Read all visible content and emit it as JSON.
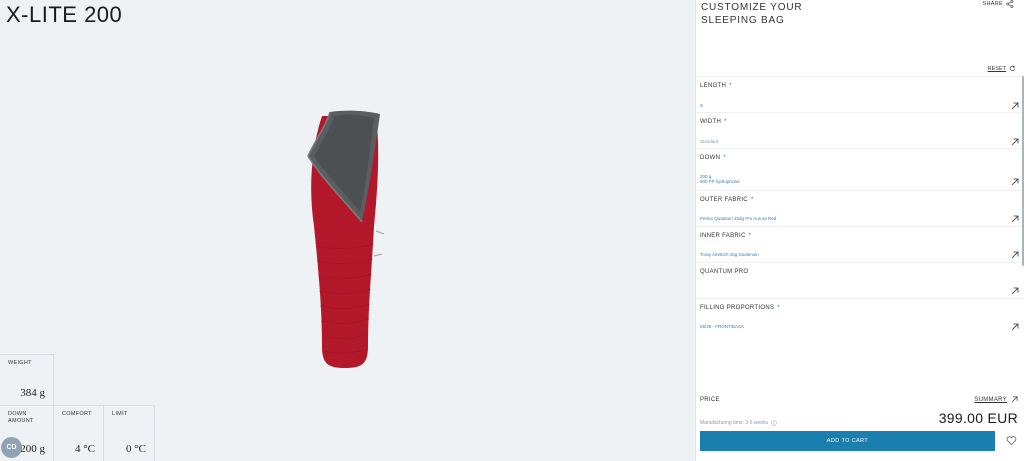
{
  "product": {
    "title": "X-LITE 200"
  },
  "stats": {
    "weight_label": "WEIGHT",
    "weight_value": "384 g",
    "down_amount_label": "DOWN AMOUNT",
    "down_amount_value": "200 g",
    "comfort_label": "COMFORT",
    "comfort_value": "4 °C",
    "limit_label": "LIMIT",
    "limit_value": "0 °C"
  },
  "chat": {
    "label": "CD"
  },
  "panel": {
    "title": "CUSTOMIZE YOUR SLEEPING BAG",
    "share_label": "SHARE",
    "reset_label": "RESET"
  },
  "options": [
    {
      "label": "LENGTH",
      "required": "*",
      "value": "S",
      "value2": ""
    },
    {
      "label": "WIDTH",
      "required": "*",
      "value": "Standard",
      "value2": ""
    },
    {
      "label": "DOWN",
      "required": "*",
      "value": "200 g",
      "value2": "900 FP hydrophobic"
    },
    {
      "label": "OUTER FABRIC",
      "required": "*",
      "value": "Pertex Quantum 15dg Pro Aurora Red",
      "value2": ""
    },
    {
      "label": "INNER FABRIC",
      "required": "*",
      "value": "Toray Airetech 15g Gaslenoin",
      "value2": ""
    },
    {
      "label": "QUANTUM PRO",
      "required": "",
      "value": "",
      "value2": ""
    },
    {
      "label": "FILLING PROPORTIONS",
      "required": "*",
      "value": "65/35 - FRONT/BACK",
      "value2": ""
    }
  ],
  "checkout": {
    "price_label": "PRICE",
    "summary_label": "SUMMARY",
    "manufacturing": "Manufacturing time: 3-5 weeks",
    "price": "399.00 EUR",
    "cart_label": "ADD TO CART"
  },
  "colors": {
    "accent": "#1a7fae",
    "link_blue": "#2f7fbf",
    "bag_red": "#b3172a",
    "bag_inner": "#5b5e61",
    "viewer_bg": "#eef2f5"
  }
}
